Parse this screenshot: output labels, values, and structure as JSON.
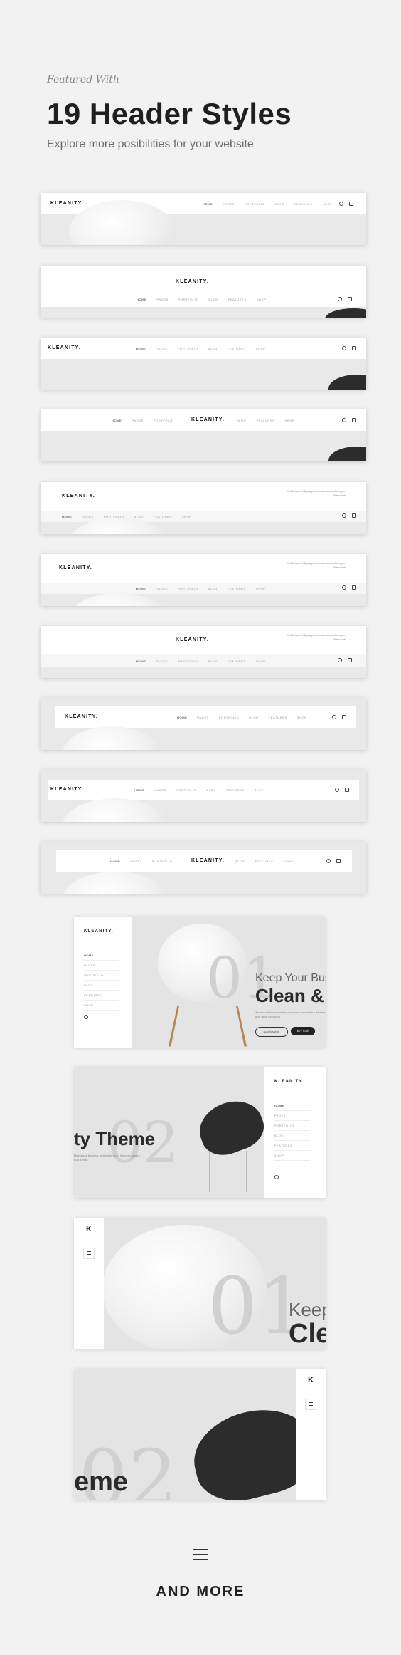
{
  "heading": {
    "featured": "Featured With",
    "title": "19 Header Styles",
    "subtitle": "Explore more posibilities for your website"
  },
  "brand": "KLEANITY.",
  "nav": [
    "HOME",
    "PAGES",
    "PORTFOLIO",
    "BLOG",
    "FEATURES",
    "SHOP"
  ],
  "nav_left": [
    "HOME",
    "PAGES",
    "PORTFOLIO"
  ],
  "nav_right": [
    "BLOG",
    "FEATURES",
    "SHOP"
  ],
  "contact": "Vestibulum id ligula porta felis euismod semper. Maecenas",
  "slide1": {
    "number": "01",
    "line1": "Keep Your Bus",
    "line2": "Clean &",
    "text": "Aenean lacinia bibendum nulla sed consectetur. Nullam quis risus eget urna.",
    "btn_primary": "LEARN MORE",
    "btn_secondary": "BUY NOW"
  },
  "slide2": {
    "number": "02",
    "line2": "ty Theme",
    "text": "Maecenas faucibus mollis interdum. Integer posuere erat a ante."
  },
  "slide3": {
    "number": "01",
    "line1": "Keep",
    "line2": "Cle"
  },
  "slide4": {
    "number": "02",
    "line2": "eme"
  },
  "mini_logo": "K",
  "footer": {
    "label": "AND MORE"
  }
}
